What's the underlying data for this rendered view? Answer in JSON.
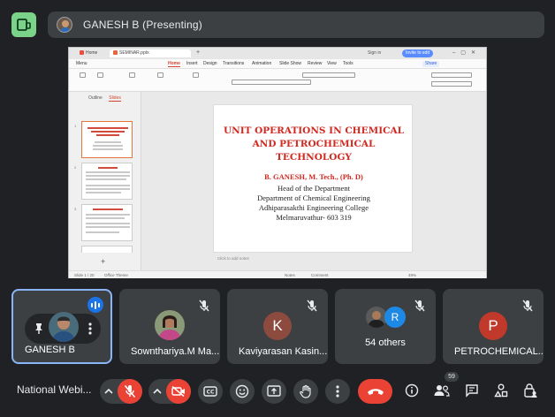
{
  "header": {
    "presenter_label": "GANESH B (Presenting)"
  },
  "shared_screen": {
    "tabs": {
      "home": "Home",
      "doc": "SEMINAR.pptx",
      "plus": "+"
    },
    "sign_in": "Sign in",
    "invite": "Invite to edit",
    "menus": [
      "Menu",
      "Home",
      "Insert",
      "Design",
      "Transitions",
      "Animation",
      "Slide Show",
      "Review",
      "View",
      "Tools"
    ],
    "active_menu": "Home",
    "share": "Share",
    "panel_tabs": {
      "outline": "Outline",
      "slides": "Slides"
    },
    "slide_numbers": [
      "1",
      "2",
      "3"
    ],
    "add_slide": "+",
    "notes_placeholder": "Click to add notes",
    "status": {
      "slide_count": "Slide 1 / 20",
      "theme": "Office Theme",
      "notes": "Notes",
      "comment": "Comment",
      "zoom": "49%"
    },
    "slide": {
      "title_lines": [
        "UNIT OPERATIONS IN CHEMICAL",
        "AND PETROCHEMICAL",
        "TECHNOLOGY"
      ],
      "author": "B. GANESH, M. Tech., (Ph. D)",
      "lines": [
        "Head of the Department",
        "Department of Chemical Engineering",
        "Adhiparasakthi Engineering College",
        "Melmaruvathur- 603 319"
      ]
    }
  },
  "participants": [
    {
      "name": "GANESH B",
      "pinned": true,
      "speaking": true
    },
    {
      "name": "Sownthariya.M Ma...",
      "muted": true
    },
    {
      "name": "Kaviyarasan Kasin...",
      "muted": true,
      "initial": "K",
      "color": "#8d4a3e"
    },
    {
      "name": "54 others",
      "muted": true,
      "initial": "R",
      "color": "#1e88e5"
    },
    {
      "name": "PETROCHEMICAL...",
      "muted": true,
      "initial": "P",
      "color": "#c0392b"
    }
  ],
  "bottom": {
    "meeting_title": "National Webi...",
    "people_count": "59"
  },
  "colors": {
    "accent_red": "#ea4335",
    "surface": "#3c4043",
    "background": "#202124",
    "highlight": "#8ab4f8"
  }
}
